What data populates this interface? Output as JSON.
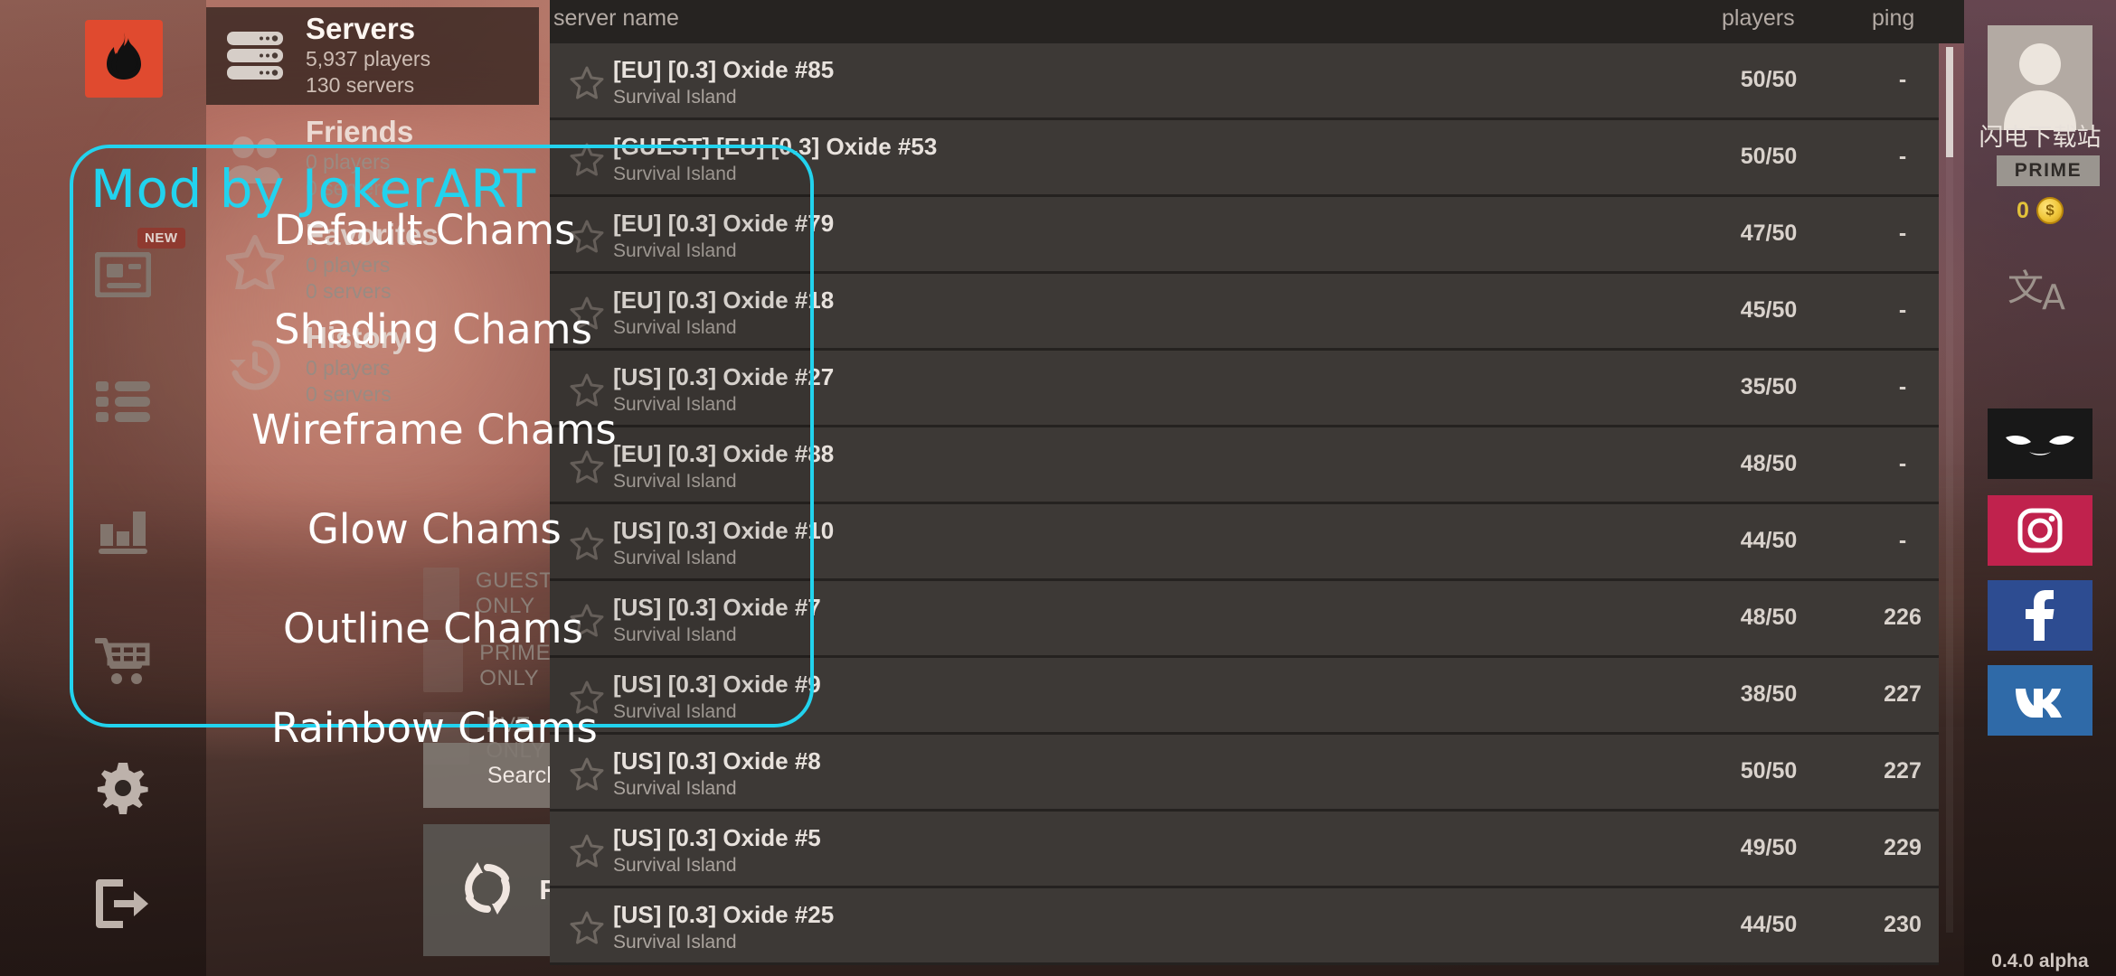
{
  "app": {
    "logo_icon": "flame-icon",
    "version": "0.4.0 alpha"
  },
  "categories": [
    {
      "title": "Servers",
      "players": "5,937 players",
      "servers": "130 servers",
      "icon": "server-rack-icon",
      "active": true
    },
    {
      "title": "Friends",
      "players": "0 players",
      "servers": "0 servers",
      "icon": "friends-icon",
      "active": false
    },
    {
      "title": "Favorites",
      "players": "0 players",
      "servers": "0 servers",
      "icon": "star-icon",
      "active": false
    },
    {
      "title": "History",
      "players": "0 players",
      "servers": "0 servers",
      "icon": "history-icon",
      "active": false
    }
  ],
  "filters": [
    {
      "label": "GUESTS ONLY",
      "checked": false
    },
    {
      "label": "PRIME ONLY",
      "checked": false
    },
    {
      "label": "PVE ONLY",
      "checked": false
    }
  ],
  "buttons": {
    "search_label": "Search Servers..",
    "refresh_label": "REFRESH",
    "refresh_icon": "refresh-icon"
  },
  "table": {
    "headers": {
      "name": "server name",
      "players": "players",
      "ping": "ping"
    },
    "rows": [
      {
        "name": "[EU] [0.3] Oxide #85",
        "map": "Survival Island",
        "players": "50/50",
        "ping": "-"
      },
      {
        "name": "[GUEST] [EU] [0.3] Oxide #53",
        "map": "Survival Island",
        "players": "50/50",
        "ping": "-"
      },
      {
        "name": "[EU] [0.3] Oxide #79",
        "map": "Survival Island",
        "players": "47/50",
        "ping": "-"
      },
      {
        "name": "[EU] [0.3] Oxide #18",
        "map": "Survival Island",
        "players": "45/50",
        "ping": "-"
      },
      {
        "name": "[US] [0.3] Oxide #27",
        "map": "Survival Island",
        "players": "35/50",
        "ping": "-"
      },
      {
        "name": "[EU] [0.3] Oxide #88",
        "map": "Survival Island",
        "players": "48/50",
        "ping": "-"
      },
      {
        "name": "[US] [0.3] Oxide #10",
        "map": "Survival Island",
        "players": "44/50",
        "ping": "-"
      },
      {
        "name": "[US] [0.3] Oxide #7",
        "map": "Survival Island",
        "players": "48/50",
        "ping": "226"
      },
      {
        "name": "[US] [0.3] Oxide #9",
        "map": "Survival Island",
        "players": "38/50",
        "ping": "227"
      },
      {
        "name": "[US] [0.3] Oxide #8",
        "map": "Survival Island",
        "players": "50/50",
        "ping": "227"
      },
      {
        "name": "[US] [0.3] Oxide #5",
        "map": "Survival Island",
        "players": "49/50",
        "ping": "229"
      },
      {
        "name": "[US] [0.3] Oxide #25",
        "map": "Survival Island",
        "players": "44/50",
        "ping": "230"
      }
    ]
  },
  "account": {
    "nickname": "闪电下载站",
    "prime_label": "PRIME",
    "coins": "0",
    "coin_icon": "coin-icon",
    "avatar_icon": "avatar-icon",
    "language_icon": "translate-icon"
  },
  "social": [
    {
      "name": "dark-mascot-icon"
    },
    {
      "name": "instagram-icon"
    },
    {
      "name": "facebook-icon"
    },
    {
      "name": "vk-icon"
    }
  ],
  "rail_icons": [
    {
      "name": "news-icon",
      "badge": "NEW"
    },
    {
      "name": "list-icon",
      "badge": ""
    },
    {
      "name": "stats-icon",
      "badge": ""
    },
    {
      "name": "cart-icon",
      "badge": ""
    },
    {
      "name": "gear-icon",
      "badge": ""
    },
    {
      "name": "logout-icon",
      "badge": ""
    }
  ],
  "mod": {
    "title": "Mod by JokerART",
    "accent_color": "#22d3ee",
    "items": [
      {
        "label": "Default Chams"
      },
      {
        "label": "Shading Chams"
      },
      {
        "label": "Wireframe Chams"
      },
      {
        "label": "Glow Chams"
      },
      {
        "label": "Outline Chams"
      },
      {
        "label": "Rainbow Chams"
      }
    ]
  }
}
